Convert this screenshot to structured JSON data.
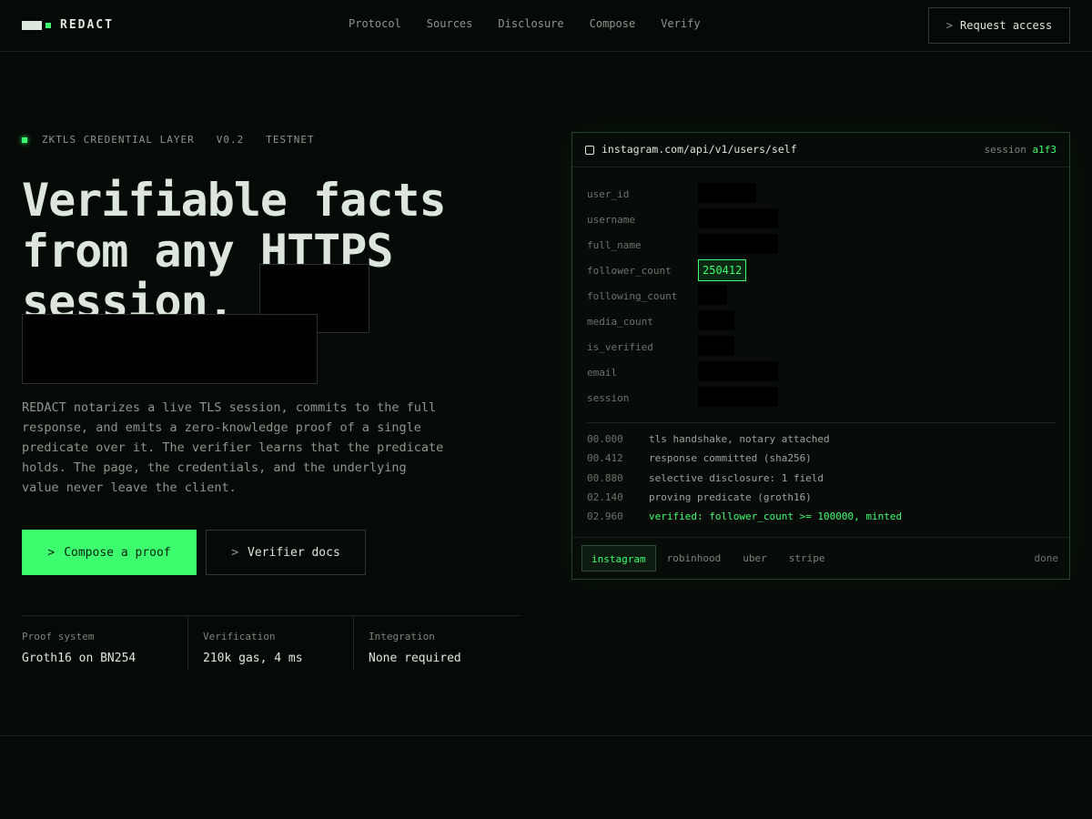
{
  "nav": {
    "brand": "REDACT",
    "links": [
      "Protocol",
      "Sources",
      "Disclosure",
      "Compose",
      "Verify"
    ],
    "cta": "Request access",
    "chevron": ">"
  },
  "hero": {
    "tag": [
      "ZKTLS CREDENTIAL LAYER",
      "V0.2",
      "TESTNET"
    ],
    "title_lines": [
      "Verifiable facts",
      "from any HTTPS",
      "session."
    ],
    "description": "REDACT notarizes a live TLS session, commits to the full response, and emits a zero-knowledge proof of a single predicate over it. The verifier learns that the predicate holds. The page, the credentials, and the underlying value never leave the client.",
    "primary_button": "Compose a proof",
    "secondary_button": "Verifier docs",
    "stats": [
      {
        "label": "Proof system",
        "value": "Groth16 on BN254"
      },
      {
        "label": "Verification",
        "value": "210k gas, 4 ms"
      },
      {
        "label": "Integration",
        "value": "None required"
      }
    ]
  },
  "panel": {
    "url": "instagram.com/api/v1/users/self",
    "session_label": "session",
    "session_id": "a1f3",
    "fields": [
      {
        "key": "user_id",
        "revealed": false
      },
      {
        "key": "username",
        "revealed": false
      },
      {
        "key": "full_name",
        "revealed": false
      },
      {
        "key": "follower_count",
        "revealed": true,
        "value": "250412"
      },
      {
        "key": "following_count",
        "revealed": false
      },
      {
        "key": "media_count",
        "revealed": false
      },
      {
        "key": "is_verified",
        "revealed": false
      },
      {
        "key": "email",
        "revealed": false
      },
      {
        "key": "session",
        "revealed": false
      }
    ],
    "log": [
      {
        "time": "00.000",
        "msg": "tls handshake, notary attached",
        "ok": false
      },
      {
        "time": "00.412",
        "msg": "response committed (sha256)",
        "ok": false
      },
      {
        "time": "00.880",
        "msg": "selective disclosure: 1 field",
        "ok": false
      },
      {
        "time": "02.140",
        "msg": "proving predicate (groth16)",
        "ok": false
      },
      {
        "time": "02.960",
        "msg": "verified: follower_count >= 100000, minted",
        "ok": true
      }
    ],
    "tabs": [
      "instagram",
      "robinhood",
      "uber",
      "stripe"
    ],
    "active_tab": "instagram",
    "status": "done"
  },
  "next_section": {
    "tag": "",
    "title": ""
  },
  "colors": {
    "accent": "#3dff6e",
    "background": "#060a07",
    "text": "#dce6dd",
    "muted": "#8c968e"
  }
}
